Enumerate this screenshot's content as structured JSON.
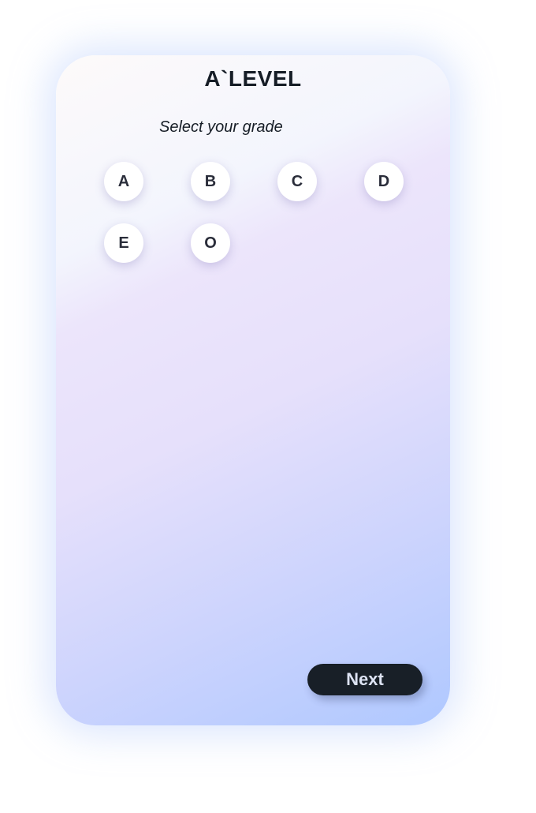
{
  "header": {
    "title": "A`LEVEL"
  },
  "prompt": "Select your grade",
  "grades": [
    "A",
    "B",
    "C",
    "D",
    "E",
    "O"
  ],
  "actions": {
    "next_label": "Next"
  }
}
